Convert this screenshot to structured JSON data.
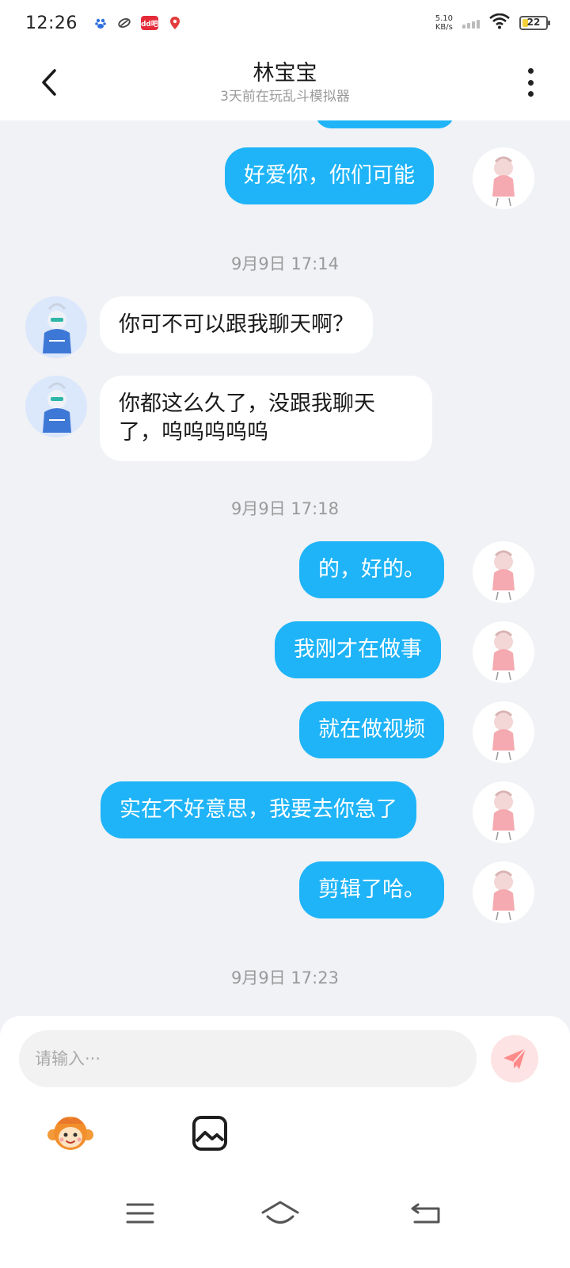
{
  "status_bar": {
    "time": "12:26",
    "net_speed_value": "5.10",
    "net_speed_unit": "KB/s",
    "battery_level": "22",
    "apps": [
      "baidu-icon",
      "sync-icon",
      "app-badge-icon",
      "location-pin-icon"
    ],
    "app_badge_text": "dd吧"
  },
  "header": {
    "title": "林宝宝",
    "subtitle": "3天前在玩乱斗模拟器"
  },
  "messages": {
    "m1": "好爱你，你们可能",
    "ts1": "9月9日 17:14",
    "m2": "你可不可以跟我聊天啊？",
    "m3": "你都这么久了，没跟我聊天了，呜呜呜呜呜",
    "ts2": "9月9日 17:18",
    "m4": "的，好的。",
    "m5": "我刚才在做事",
    "m6": "就在做视频",
    "m7": "实在不好意思，我要去你急了",
    "m8": "剪辑了哈。",
    "ts3": "9月9日 17:23"
  },
  "input": {
    "placeholder": "请输入···",
    "value": ""
  },
  "colors": {
    "outgoing_bubble": "#1fb4f8",
    "incoming_bubble": "#ffffff",
    "chat_background": "#f0f2f5",
    "send_button_bg": "#fde3e3",
    "send_icon": "#ff8a8a"
  },
  "icons": {
    "back": "chevron-left-icon",
    "more": "more-vertical-icon",
    "send": "send-icon",
    "sticker": "monkey-sticker-icon",
    "image": "image-icon",
    "nav_menu": "menu-icon",
    "nav_home": "home-icon",
    "nav_back": "return-icon"
  }
}
